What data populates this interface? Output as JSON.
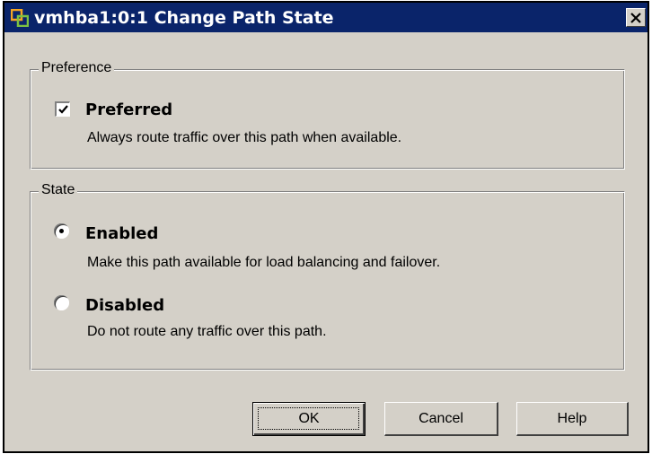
{
  "window": {
    "title": "vmhba1:0:1 Change Path State",
    "app_icon": "vmware-icon",
    "close_glyph": "✕"
  },
  "preference": {
    "legend": "Preference",
    "preferred": {
      "label": "Preferred",
      "checked": true,
      "description": "Always route traffic over this path when available."
    }
  },
  "state": {
    "legend": "State",
    "options": [
      {
        "label": "Enabled",
        "selected": true,
        "description": "Make this path available for load balancing and failover."
      },
      {
        "label": "Disabled",
        "selected": false,
        "description": "Do not route any traffic over this path."
      }
    ]
  },
  "buttons": {
    "ok": "OK",
    "cancel": "Cancel",
    "help": "Help"
  }
}
